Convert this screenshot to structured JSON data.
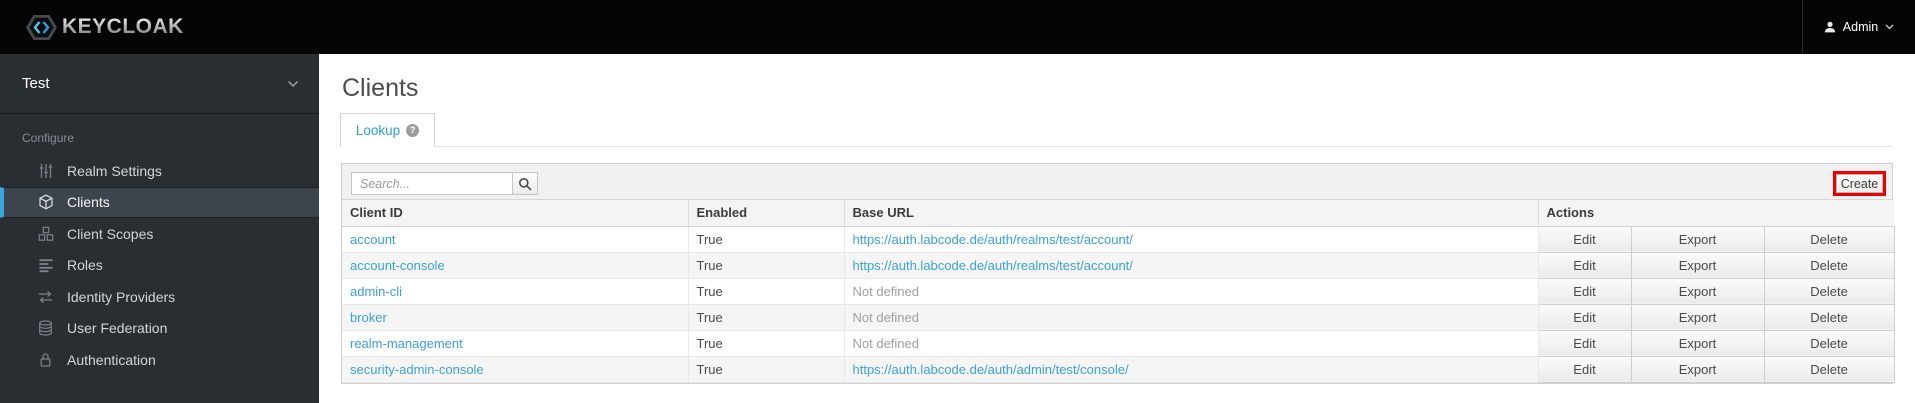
{
  "header": {
    "brand": "KEYCLOAK",
    "user": {
      "name": "Admin"
    }
  },
  "sidebar": {
    "realm": "Test",
    "section_label": "Configure",
    "items": [
      {
        "label": "Realm Settings",
        "icon": "sliders-icon",
        "selected": false
      },
      {
        "label": "Clients",
        "icon": "cube-icon",
        "selected": true
      },
      {
        "label": "Client Scopes",
        "icon": "cubes-icon",
        "selected": false
      },
      {
        "label": "Roles",
        "icon": "list-icon",
        "selected": false
      },
      {
        "label": "Identity Providers",
        "icon": "exchange-arrows-icon",
        "selected": false
      },
      {
        "label": "User Federation",
        "icon": "database-icon",
        "selected": false
      },
      {
        "label": "Authentication",
        "icon": "lock-icon",
        "selected": false
      }
    ]
  },
  "main": {
    "title": "Clients",
    "tab": {
      "label": "Lookup",
      "help_icon": "question-circle-icon"
    },
    "toolbar": {
      "search_placeholder": "Search...",
      "search_icon": "search-icon",
      "create_label": "Create",
      "create_highlight_color": "#e90000"
    },
    "table": {
      "columns": [
        "Client ID",
        "Enabled",
        "Base URL",
        "Actions"
      ],
      "actions": [
        "Edit",
        "Export",
        "Delete"
      ],
      "rows": [
        {
          "client_id": "account",
          "enabled": "True",
          "base_url": "https://auth.labcode.de/auth/realms/test/account/"
        },
        {
          "client_id": "account-console",
          "enabled": "True",
          "base_url": "https://auth.labcode.de/auth/realms/test/account/"
        },
        {
          "client_id": "admin-cli",
          "enabled": "True",
          "base_url": "Not defined"
        },
        {
          "client_id": "broker",
          "enabled": "True",
          "base_url": "Not defined"
        },
        {
          "client_id": "realm-management",
          "enabled": "True",
          "base_url": "Not defined"
        },
        {
          "client_id": "security-admin-console",
          "enabled": "True",
          "base_url": "https://auth.labcode.de/auth/admin/test/console/"
        }
      ]
    }
  },
  "colors": {
    "accent_blue": "#3aa6dd",
    "link_blue": "#3ba1d9",
    "sidebar_bg": "#292e33",
    "sidebar_selected_bg": "#3e444b",
    "header_bg": "#050505",
    "highlight_red": "#e90000"
  }
}
